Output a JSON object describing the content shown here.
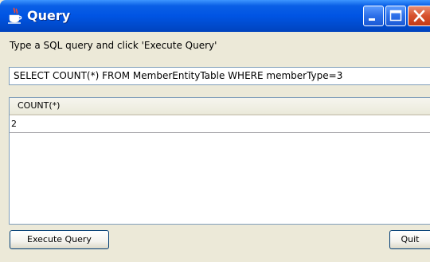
{
  "window": {
    "title": "Query",
    "icon": "java-coffee-cup-icon"
  },
  "titlebar_buttons": {
    "minimize": "minimize-icon",
    "maximize": "maximize-icon",
    "close": "close-icon"
  },
  "prompt": "Type a SQL query and click 'Execute Query'",
  "query": {
    "value": "SELECT COUNT(*) FROM MemberEntityTable WHERE memberType=3"
  },
  "results": {
    "columns": [
      "COUNT(*)"
    ],
    "rows": [
      [
        "2"
      ]
    ]
  },
  "buttons": {
    "execute": "Execute Query",
    "quit": "Quit"
  },
  "colors": {
    "titlebar": "#0054e3",
    "window_bg": "#ece9d8",
    "close_button": "#d6502c",
    "input_border": "#7f9db9"
  }
}
